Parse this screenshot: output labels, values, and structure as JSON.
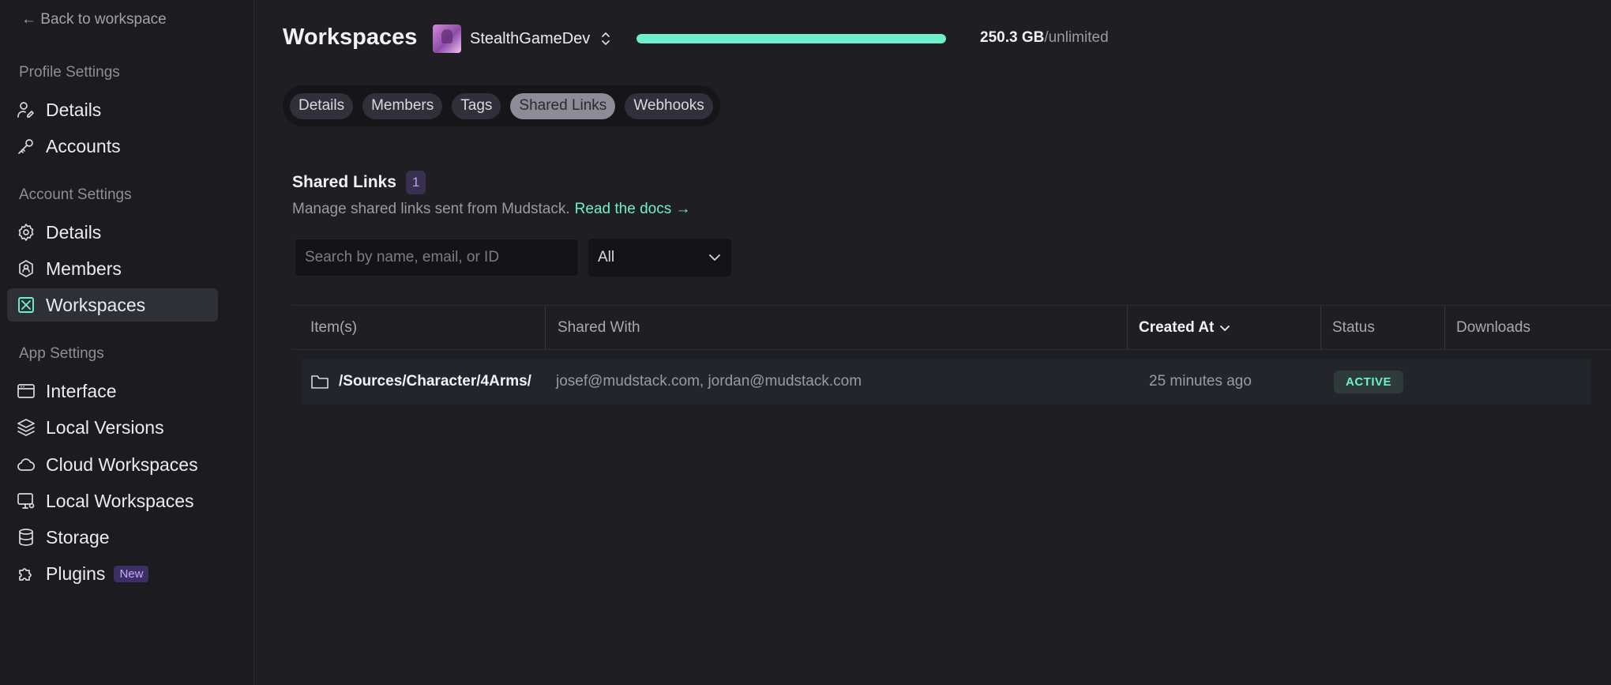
{
  "sidebar": {
    "back_label": "← Back to workspace",
    "sections": [
      {
        "label": "Profile Settings"
      },
      {
        "label": "Account Settings"
      },
      {
        "label": "App Settings"
      }
    ],
    "items": [
      {
        "label": "Details",
        "icon": "user-pen-icon"
      },
      {
        "label": "Accounts",
        "icon": "key-icon"
      },
      {
        "label": "Details",
        "icon": "gear-icon"
      },
      {
        "label": "Members",
        "icon": "shield-user-icon"
      },
      {
        "label": "Workspaces",
        "icon": "workspace-icon",
        "active": true
      },
      {
        "label": "Interface",
        "icon": "window-icon"
      },
      {
        "label": "Local Versions",
        "icon": "layers-icon"
      },
      {
        "label": "Cloud Workspaces",
        "icon": "cloud-icon"
      },
      {
        "label": "Local Workspaces",
        "icon": "monitor-icon"
      },
      {
        "label": "Storage",
        "icon": "database-icon"
      },
      {
        "label": "Plugins",
        "icon": "puzzle-icon",
        "badge": "New"
      }
    ]
  },
  "header": {
    "title": "Workspaces",
    "workspace_name": "StealthGameDev",
    "storage_used": "250.3 GB",
    "storage_limit": "/unlimited",
    "usage_progress": 1.0
  },
  "tabs": [
    {
      "label": "Details"
    },
    {
      "label": "Members"
    },
    {
      "label": "Tags"
    },
    {
      "label": "Shared Links",
      "active": true
    },
    {
      "label": "Webhooks"
    }
  ],
  "section": {
    "title": "Shared Links",
    "count": "1",
    "description": "Manage shared links sent from Mudstack.",
    "docs_link": "Read the docs →"
  },
  "filters": {
    "search_placeholder": "Search by name, email, or ID",
    "select_value": "All"
  },
  "table": {
    "columns": [
      "Item(s)",
      "Shared With",
      "Created At",
      "Status",
      "Downloads"
    ],
    "rows": [
      {
        "item": "/Sources/Character/4Arms/",
        "shared_with": "josef@mudstack.com, jordan@mudstack.com",
        "created_at": "25 minutes ago",
        "status": "ACTIVE",
        "downloads": ""
      }
    ]
  },
  "colors": {
    "accent": "#6ef0cf",
    "background": "#1e1e23",
    "sidebar": "#1b1b20",
    "badge_purple": "#3c2f63"
  }
}
